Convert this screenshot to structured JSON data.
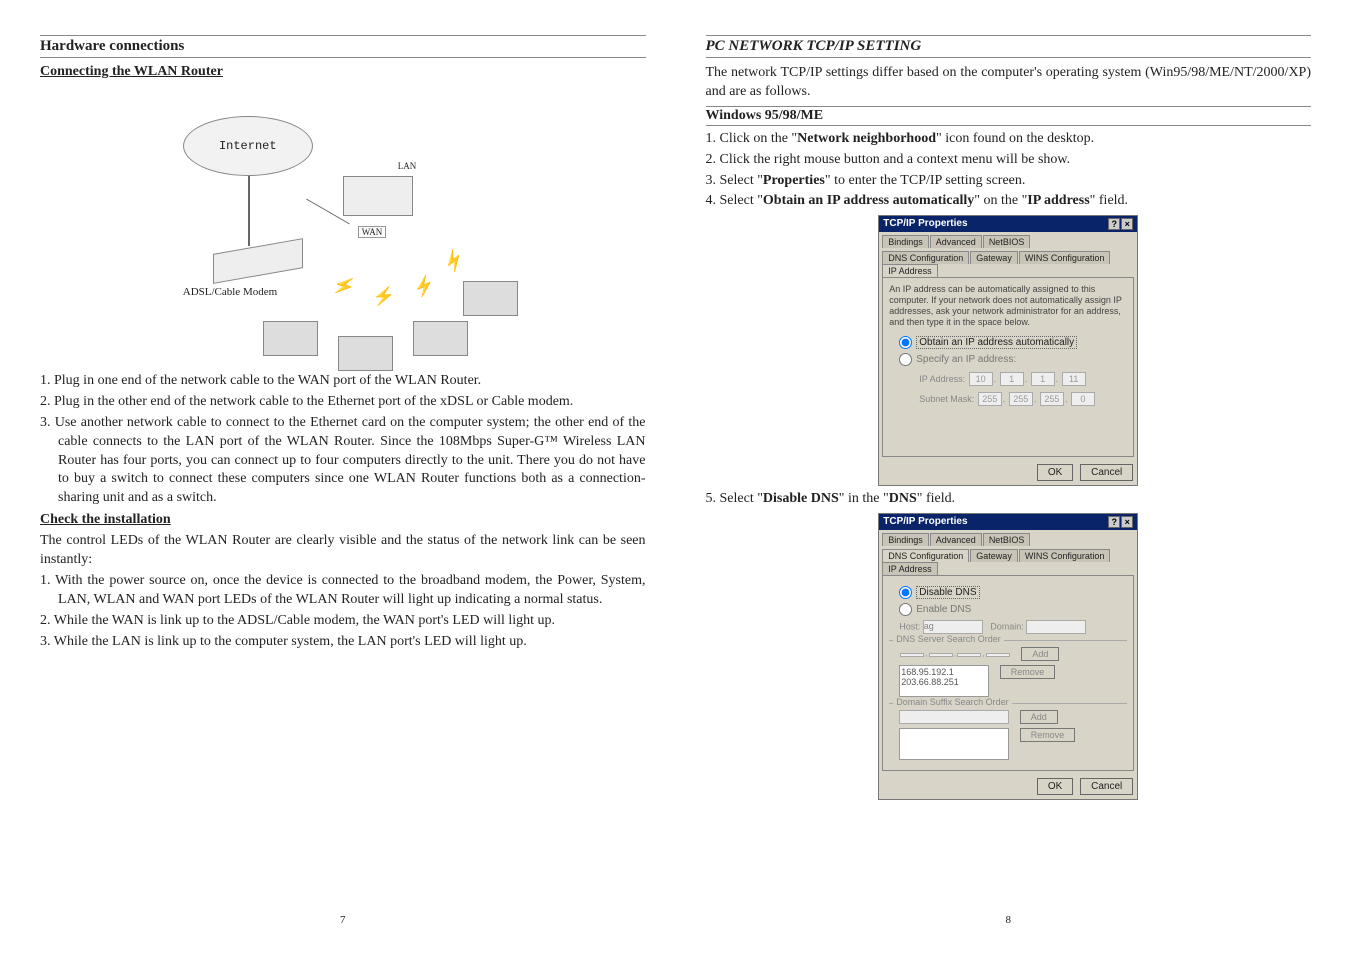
{
  "left": {
    "section_title": "Hardware connections",
    "sub1": "Connecting the WLAN Router",
    "diagram": {
      "cloud": "Internet",
      "modem_label": "ADSL/Cable Modem",
      "wan": "WAN",
      "lan": "LAN"
    },
    "steps_connect": [
      "1. Plug in one end of the network cable to the WAN port of the WLAN Router.",
      "2. Plug in the other end of the network cable to the Ethernet port of the xDSL or Cable modem.",
      "3. Use another network cable to connect to the Ethernet card on the computer system; the other end of the cable connects to the LAN port of the WLAN Router. Since the 108Mbps Super-G™ Wireless LAN Router has four ports, you can connect up to four computers directly to the unit. There you do not have to buy a switch to connect these computers since one WLAN Router functions both as a connection-sharing unit and as a switch."
    ],
    "sub2": "Check the installation",
    "check_intro": "The control LEDs of the WLAN Router are clearly visible and the status of the network link can be seen instantly:",
    "steps_check": [
      "1. With the power source on, once the device is connected to the broadband modem, the Power, System, LAN, WLAN and WAN port LEDs of the WLAN Router will light up indicating a normal status.",
      "2. While the WAN is link up to the ADSL/Cable modem, the WAN port's LED will light up.",
      "3. While the LAN is link up to the computer system, the LAN port's LED will light up."
    ],
    "page_number": "7"
  },
  "right": {
    "section_title": "PC NETWORK TCP/IP SETTING",
    "intro": "The network TCP/IP settings differ based on the computer's operating system (Win95/98/ME/NT/2000/XP) and are as follows.",
    "sub1": "Windows 95/98/ME",
    "steps1": [
      {
        "pre": "1. Click on the \"",
        "bold": "Network neighborhood",
        "post": "\" icon found on the desktop."
      },
      {
        "pre": "2. Click the right mouse button and a context menu will be show.",
        "bold": "",
        "post": ""
      },
      {
        "pre": "3. Select \"",
        "bold": "Properties",
        "post": "\" to enter the TCP/IP setting screen."
      },
      {
        "pre": "4. Select \"",
        "bold": "Obtain an IP address automatically",
        "post": "\" on the \"",
        "bold2": "IP address",
        "post2": "\" field."
      }
    ],
    "dialog1": {
      "title": "TCP/IP Properties",
      "tabs_row1": [
        "Bindings",
        "Advanced",
        "NetBIOS"
      ],
      "tabs_row2": [
        "DNS Configuration",
        "Gateway",
        "WINS Configuration",
        "IP Address"
      ],
      "info": "An IP address can be automatically assigned to this computer. If your network does not automatically assign IP addresses, ask your network administrator for an address, and then type it in the space below.",
      "radio1": "Obtain an IP address automatically",
      "radio2": "Specify an IP address:",
      "ip_label": "IP Address:",
      "ip": [
        "10",
        "1",
        "1",
        "11"
      ],
      "mask_label": "Subnet Mask:",
      "mask": [
        "255",
        "255",
        "255",
        "0"
      ],
      "ok": "OK",
      "cancel": "Cancel"
    },
    "step5": {
      "pre": "5. Select \"",
      "bold": "Disable DNS",
      "post": "\" in the \"",
      "bold2": "DNS",
      "post2": "\" field."
    },
    "dialog2": {
      "title": "TCP/IP Properties",
      "tabs_row1": [
        "Bindings",
        "Advanced",
        "NetBIOS"
      ],
      "tabs_row2": [
        "DNS Configuration",
        "Gateway",
        "WINS Configuration",
        "IP Address"
      ],
      "radio1": "Disable DNS",
      "radio2": "Enable DNS",
      "host_label": "Host:",
      "host_value": "ag",
      "domain_label": "Domain:",
      "group1": "DNS Server Search Order",
      "list1a": "168.95.192.1",
      "list1b": "203.66.88.251",
      "add": "Add",
      "remove": "Remove",
      "group2": "Domain Suffix Search Order",
      "ok": "OK",
      "cancel": "Cancel"
    },
    "page_number": "8"
  }
}
